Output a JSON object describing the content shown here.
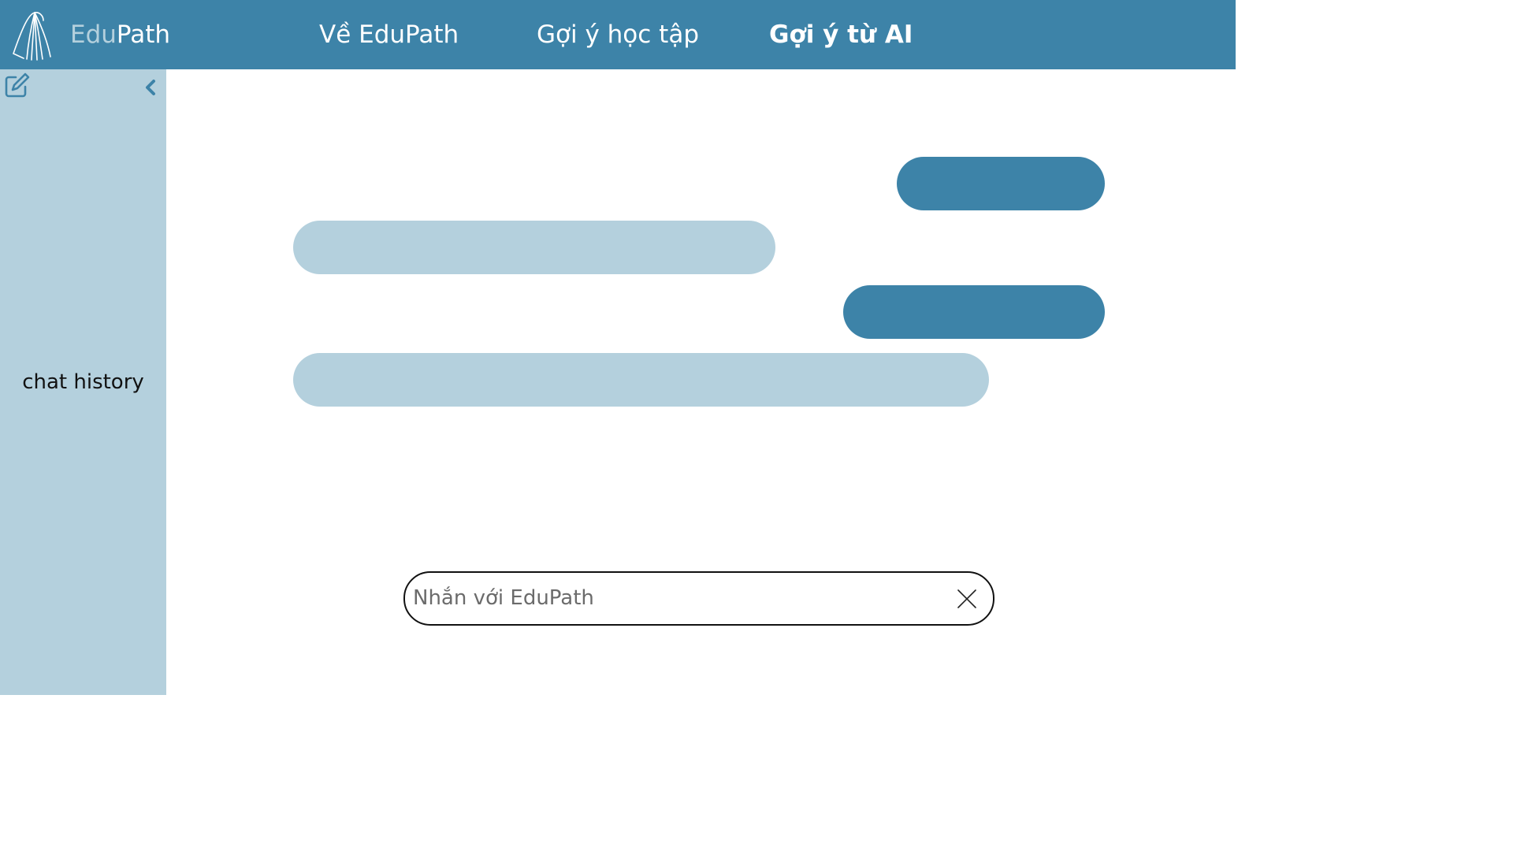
{
  "header": {
    "brand_part1": "Edu",
    "brand_part2": "Path",
    "nav": [
      {
        "label": "Về EduPath"
      },
      {
        "label": "Gợi ý học tập"
      },
      {
        "label": "Gợi ý từ AI",
        "active": true
      }
    ]
  },
  "sidebar": {
    "history_label": "chat history",
    "icons": [
      "edit-icon",
      "chevron-left-icon"
    ]
  },
  "chat": {
    "messages": [
      {
        "role": "user",
        "text": ""
      },
      {
        "role": "assistant",
        "text": ""
      },
      {
        "role": "user",
        "text": ""
      },
      {
        "role": "assistant",
        "text": ""
      }
    ]
  },
  "composer": {
    "placeholder": "Nhắn với EduPath",
    "value": "",
    "clear_icon": "close-icon"
  },
  "colors": {
    "primary": "#3d83a8",
    "light": "#b4d0dd",
    "background": "#ffffff"
  }
}
